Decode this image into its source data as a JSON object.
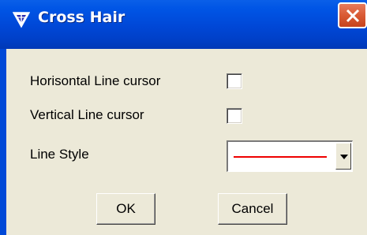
{
  "window": {
    "title": "Cross Hair",
    "app_icon": "triangle-logo-icon",
    "close_icon": "close-icon"
  },
  "form": {
    "horizontal_label": "Horisontal Line cursor",
    "horizontal_checked": false,
    "vertical_label": "Vertical Line cursor",
    "vertical_checked": false,
    "line_style_label": "Line Style",
    "line_style_value": "solid-red-line",
    "line_style_color": "#ee0000"
  },
  "buttons": {
    "ok_label": "OK",
    "cancel_label": "Cancel"
  },
  "colors": {
    "titlebar": "#0047d6",
    "close_button": "#d95a34",
    "dialog_background": "#ece9d8"
  }
}
